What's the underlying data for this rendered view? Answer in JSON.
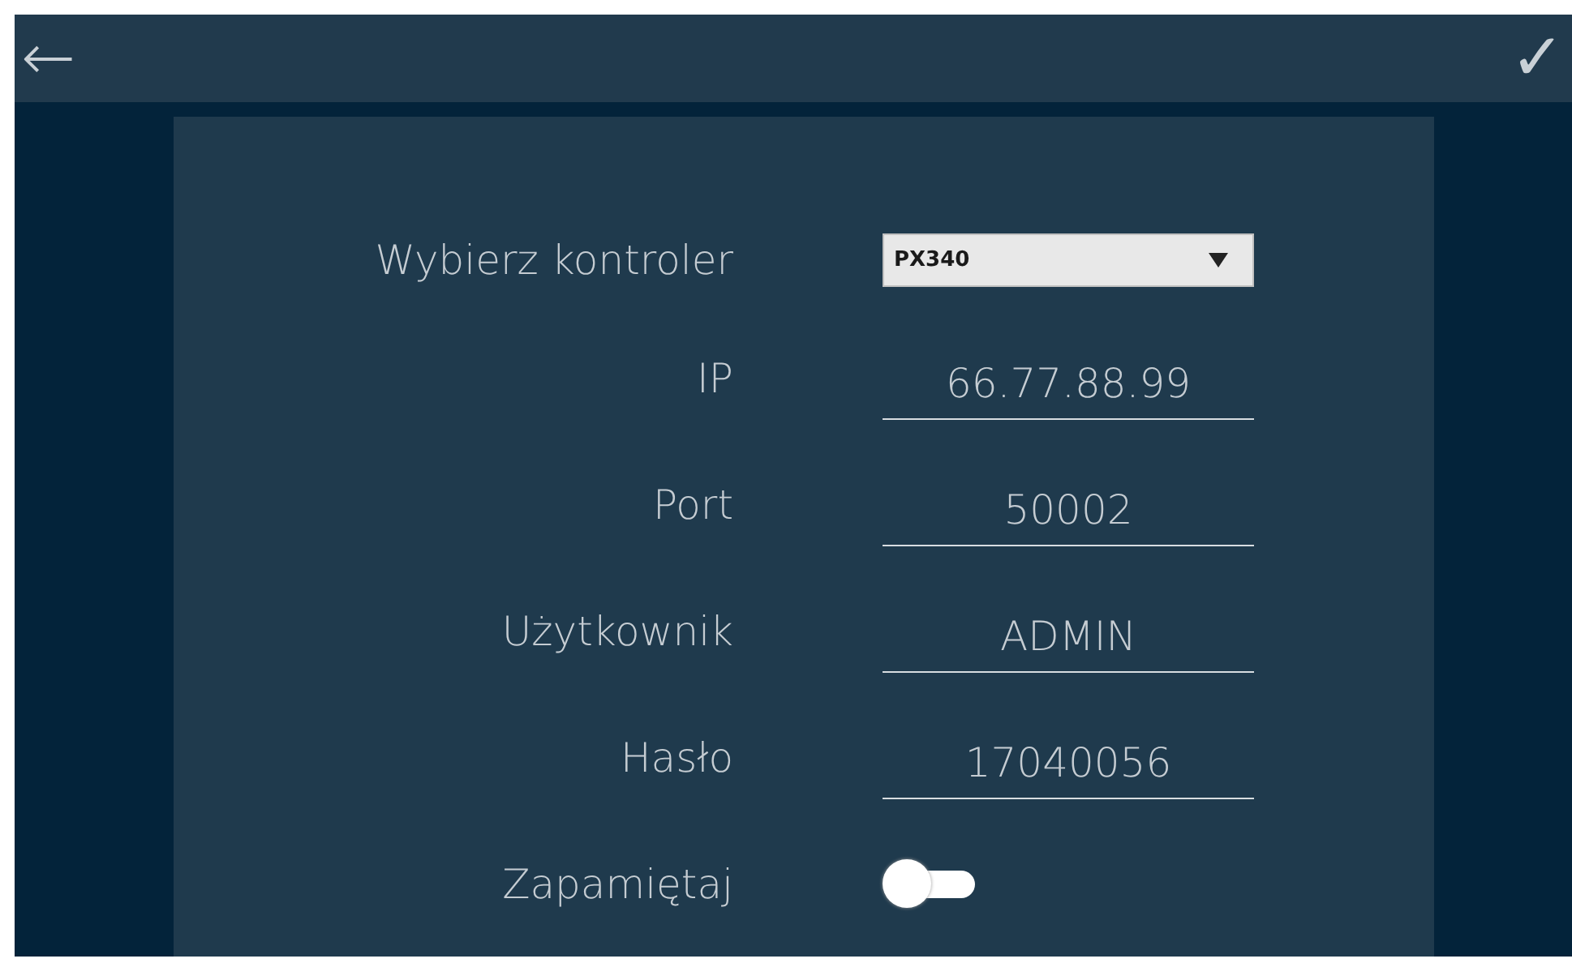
{
  "header": {
    "back_icon": "←",
    "confirm_icon": "✓"
  },
  "fields": [
    {
      "kind": "dropdown",
      "label": "Wybierz kontroler",
      "value": "PX340"
    },
    {
      "kind": "text",
      "label": "IP",
      "value": "66.77.88.99"
    },
    {
      "kind": "text",
      "label": "Port",
      "value": "50002"
    },
    {
      "kind": "text",
      "label": "Użytkownik",
      "value": "ADMIN"
    },
    {
      "kind": "text",
      "label": "Hasło",
      "value": "17040056"
    },
    {
      "kind": "toggle",
      "label": "Zapamiętaj",
      "on": false
    }
  ]
}
